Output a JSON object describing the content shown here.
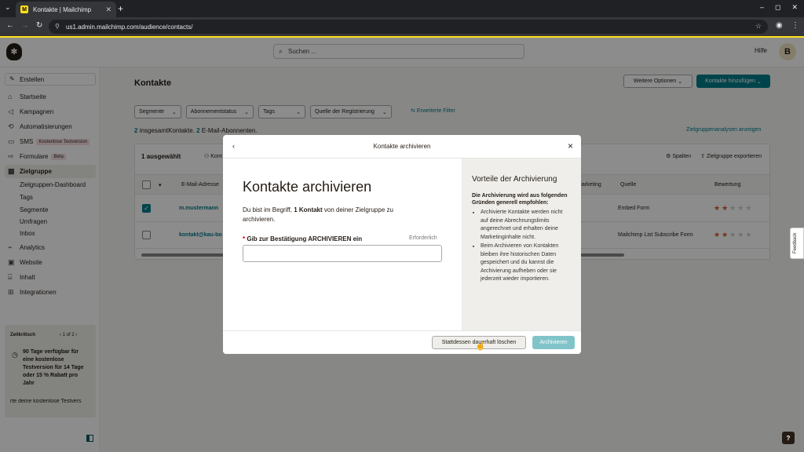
{
  "browser": {
    "tab_title": "Kontakte | Mailchimp",
    "tab_favicon": "M",
    "url": "us1.admin.mailchimp.com/audience/contacts/"
  },
  "header": {
    "search_placeholder": "Suchen ...",
    "help_label": "Hilfe",
    "avatar_initial": "B"
  },
  "sidebar": {
    "create_label": "Erstellen",
    "items": [
      {
        "label": "Startseite",
        "icon": "home-icon"
      },
      {
        "label": "Kampagnen",
        "icon": "megaphone-icon"
      },
      {
        "label": "Automatisierungen",
        "icon": "automation-icon"
      },
      {
        "label": "SMS",
        "icon": "sms-icon",
        "badge": "Kostenlose Testversion"
      },
      {
        "label": "Formulare",
        "icon": "form-icon",
        "badge": "Beta"
      },
      {
        "label": "Zielgruppe",
        "icon": "audience-icon",
        "active": true
      }
    ],
    "subitems": [
      "Zielgruppen-Dashboard",
      "Tags",
      "Segmente",
      "Umfragen",
      "Inbox"
    ],
    "items2": [
      {
        "label": "Analytics",
        "icon": "analytics-icon"
      },
      {
        "label": "Website",
        "icon": "website-icon"
      },
      {
        "label": "Inhalt",
        "icon": "content-icon"
      },
      {
        "label": "Integrationen",
        "icon": "integrations-icon"
      }
    ],
    "trial": {
      "title": "Zeitkritisch",
      "pager": "1 of 2",
      "text": "90 Tage verfügbar für eine kostenlose Testversion für 14 Tage oder 15 % Rabatt pro Jahr",
      "link": "rte deine kostenlose Testvers"
    }
  },
  "main": {
    "title": "Kontakte",
    "options_btn": "Weitere Optionen",
    "add_btn": "Kontakte hinzufügen",
    "filters": [
      "Segmente",
      "Abonnementstatus",
      "Tags",
      "Quelle der Registrierung"
    ],
    "adv_filter": "Erweiterte Filter",
    "summary": {
      "total_num": "2",
      "total_text": " insgesamtKontakte. ",
      "sub_num": "2",
      "sub_text": " E-Mail-Abonnenten."
    },
    "zg_link": "Zielgruppenanalysen anzeigen",
    "selected": "1 ausgewählt",
    "partial_action": "Kont",
    "columns_btn": "Spalten",
    "export_btn": "Zielgruppe exportieren",
    "headers": {
      "email": "E-Mail-Adresse",
      "marketing": "Marketing",
      "source": "Quelle",
      "rating": "Bewertung"
    },
    "rows": [
      {
        "email": "m.mustermann",
        "source": "Embed Form",
        "checked": true,
        "rating": 2
      },
      {
        "email": "kontakt@kau-bo",
        "source": "Mailchimp List Subscribe Form",
        "checked": false,
        "rating": 2
      }
    ]
  },
  "feedback_label": "Feedback",
  "help_button": "?",
  "modal": {
    "header_title": "Kontakte archivieren",
    "heading": "Kontakte archivieren",
    "desc_pre": "Du bist im Begriff, ",
    "desc_bold": "1 Kontakt",
    "desc_post": " von deiner Zielgruppe zu archivieren.",
    "input_label": "Gib zur Bestätigung ARCHIVIEREN ein",
    "required": "Erforderlich",
    "right_heading": "Vorteile der Archivierung",
    "right_sub": "Die Archivierung wird aus folgenden Gründen generell empfohlen:",
    "bullets": [
      "Archivierte Kontakte werden nicht auf deine Abrechnungslimits angerechnet und erhalten deine Marketinginhalte nicht.",
      "Beim Archivieren von Kontakten bleiben ihre historischen Daten gespeichert und du kannst die Archivierung aufheben oder sie jederzeit wieder importieren."
    ],
    "delete_btn": "Stattdessen dauerhaft löschen",
    "archive_btn": "Archivieren"
  },
  "colors": {
    "accent": "#007c89",
    "brand_yellow": "#ffe01b",
    "star": "#d05b2d"
  }
}
